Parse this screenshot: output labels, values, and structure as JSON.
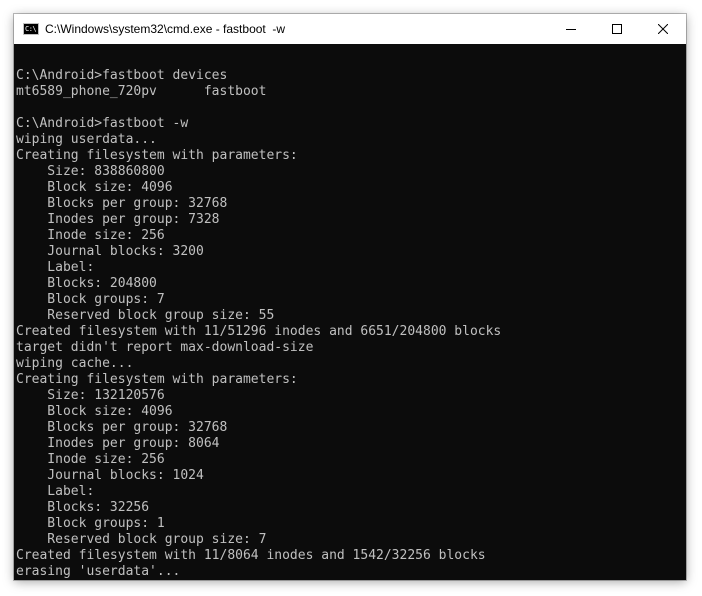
{
  "window": {
    "title": "C:\\Windows\\system32\\cmd.exe - fastboot  -w",
    "icon_label": "C:\\",
    "icons": {
      "app": "cmd-app-icon",
      "minimize": "minimize-icon",
      "maximize": "maximize-icon",
      "close": "close-icon"
    }
  },
  "colors": {
    "console_bg": "#0c0c0c",
    "console_text": "#c0c0c0",
    "titlebar_bg": "#ffffff"
  },
  "console": {
    "lines": [
      "",
      "C:\\Android>fastboot devices",
      "mt6589_phone_720pv      fastboot",
      "",
      "C:\\Android>fastboot -w",
      "wiping userdata...",
      "Creating filesystem with parameters:",
      "    Size: 838860800",
      "    Block size: 4096",
      "    Blocks per group: 32768",
      "    Inodes per group: 7328",
      "    Inode size: 256",
      "    Journal blocks: 3200",
      "    Label:",
      "    Blocks: 204800",
      "    Block groups: 7",
      "    Reserved block group size: 55",
      "Created filesystem with 11/51296 inodes and 6651/204800 blocks",
      "target didn't report max-download-size",
      "wiping cache...",
      "Creating filesystem with parameters:",
      "    Size: 132120576",
      "    Block size: 4096",
      "    Blocks per group: 32768",
      "    Inodes per group: 8064",
      "    Inode size: 256",
      "    Journal blocks: 1024",
      "    Label:",
      "    Blocks: 32256",
      "    Block groups: 1",
      "    Reserved block group size: 7",
      "Created filesystem with 11/8064 inodes and 1542/32256 blocks",
      "erasing 'userdata'..."
    ]
  }
}
